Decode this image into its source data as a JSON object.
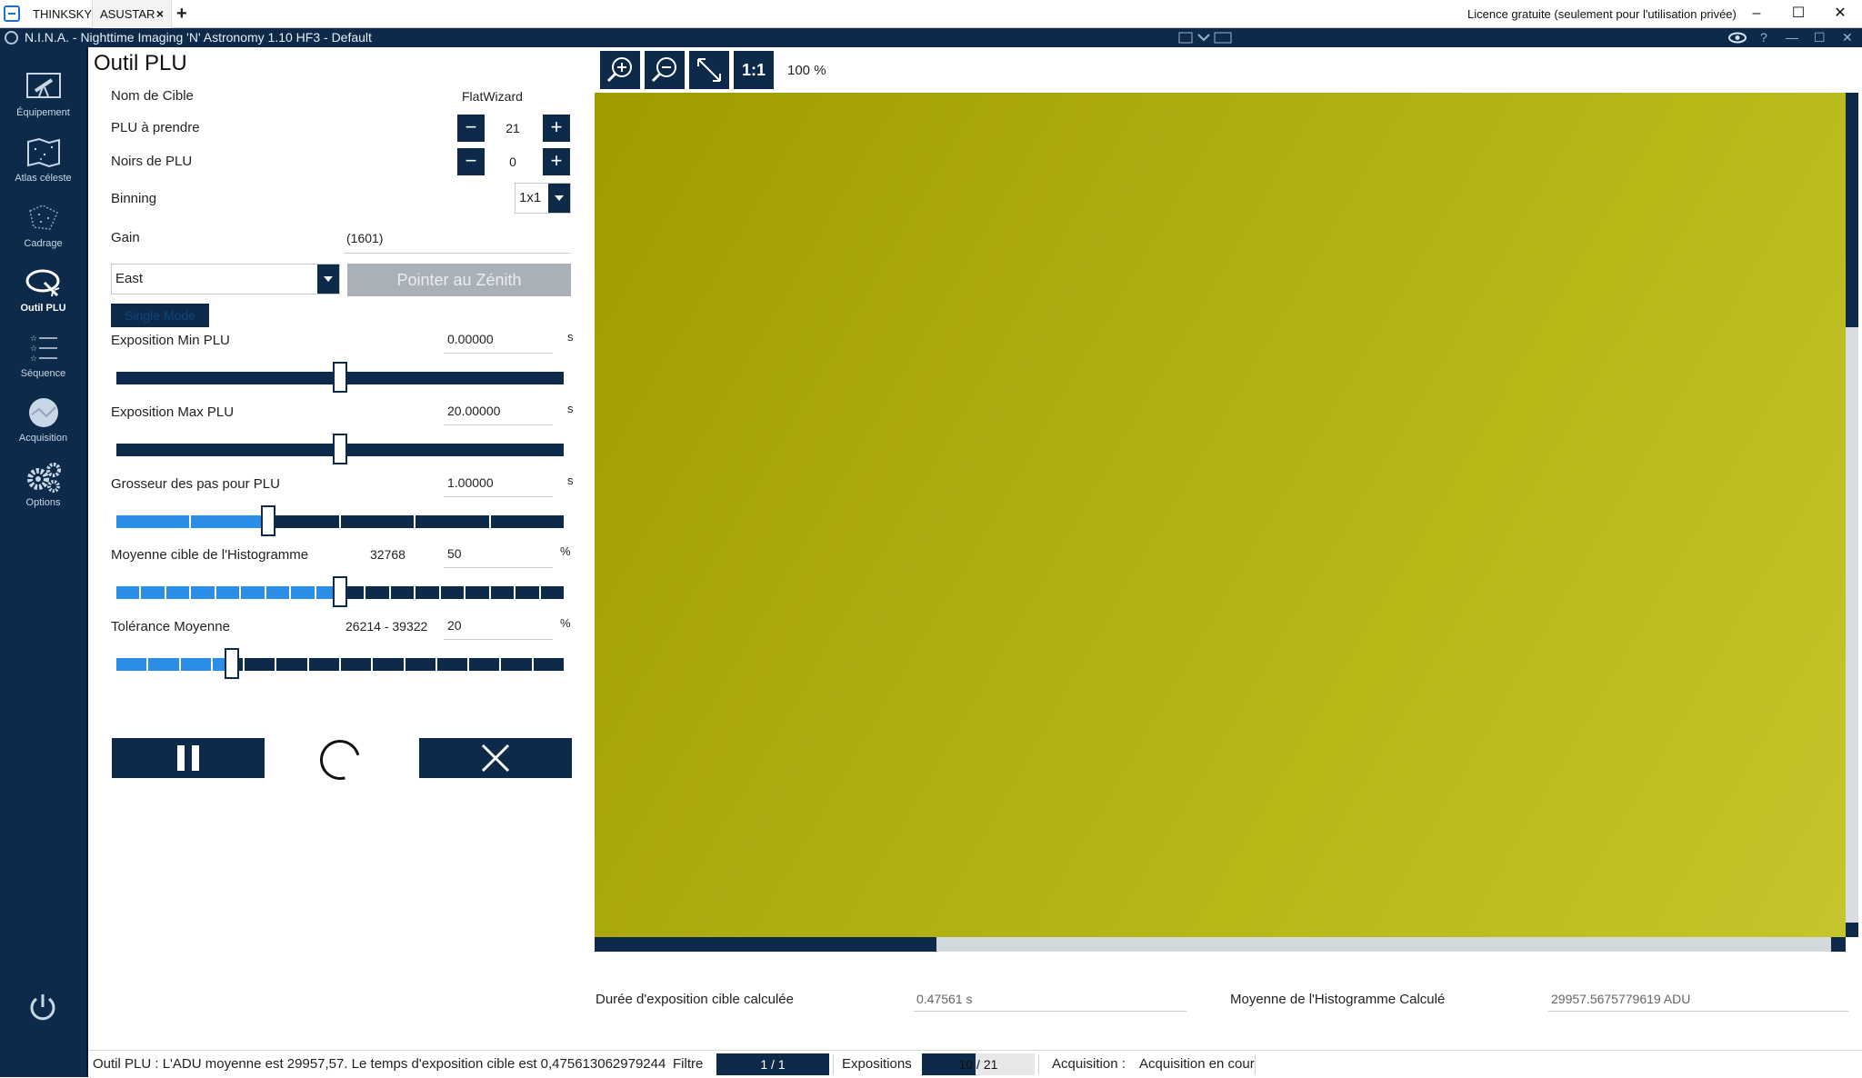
{
  "tabs": [
    {
      "label": "THINKSKY"
    },
    {
      "label": "ASUSTAR",
      "close": "×"
    }
  ],
  "new_tab": "+",
  "licence": "Licence gratuite (seulement pour l'utilisation privée)",
  "window_controls": {
    "minimize": "–",
    "maximize": "☐",
    "close": "✕"
  },
  "app": {
    "title": "N.I.N.A. - Nighttime Imaging 'N' Astronomy 1.10 HF3   -  Default"
  },
  "nav": [
    {
      "label": "Équipement",
      "icon": "telescope-icon"
    },
    {
      "label": "Atlas céleste",
      "icon": "sky-atlas-icon"
    },
    {
      "label": "Cadrage",
      "icon": "framing-icon"
    },
    {
      "label": "Outil PLU",
      "icon": "flat-wizard-icon",
      "active": true
    },
    {
      "label": "Séquence",
      "icon": "sequence-icon"
    },
    {
      "label": "Acquisition",
      "icon": "imaging-icon"
    },
    {
      "label": "Options",
      "icon": "gears-icon"
    }
  ],
  "panel": {
    "title": "Outil PLU",
    "target_name_label": "Nom de Cible",
    "target_name_value": "FlatWizard",
    "flats_label": "PLU à prendre",
    "flats_value": "21",
    "darks_label": "Noirs de PLU",
    "darks_value": "0",
    "binning_label": "Binning",
    "binning_value": "1x1",
    "gain_label": "Gain",
    "gain_value": "(1601)",
    "direction_value": "East",
    "zenith_button": "Pointer au Zénith",
    "single_mode": "Single Mode",
    "exp_min_label": "Exposition Min PLU",
    "exp_min_value": "0.00000",
    "exp_min_unit": "s",
    "exp_max_label": "Exposition Max PLU",
    "exp_max_value": "20.00000",
    "exp_max_unit": "s",
    "step_label": "Grosseur des pas pour PLU",
    "step_value": "1.00000",
    "step_unit": "s",
    "hist_label": "Moyenne cible de l'Histogramme",
    "hist_adu": "32768",
    "hist_value": "50",
    "hist_unit": "%",
    "tol_label": "Tolérance Moyenne",
    "tol_range": "26214 - 39322",
    "tol_value": "20",
    "tol_unit": "%",
    "sliders": {
      "exp_min": 0.5,
      "exp_max": 0.5,
      "step": 0.34,
      "hist": 0.5,
      "tol": 0.26
    },
    "pause_icon": "pause-icon",
    "cancel_icon": "close-icon"
  },
  "viewer": {
    "zoom_text": "100 %",
    "one_to_one": "1:1",
    "image_color": "#b2b112",
    "calc_exp_label": "Durée d'exposition cible calculée",
    "calc_exp_value": "0.47561 s",
    "calc_hist_label": "Moyenne de l'Histogramme Calculé",
    "calc_hist_value": "29957.5675779619 ADU"
  },
  "status": {
    "message": "Outil PLU :   L'ADU moyenne est 29957,57. Le temps d'exposition cible est 0,475613062979244",
    "filter_label": "Filtre",
    "filter_progress": "1 / 1",
    "filter_fraction": 1.0,
    "exposures_label": "Expositions",
    "exposures_progress": "10 / 21",
    "exposures_fraction": 0.476,
    "acq_label": "Acquisition :",
    "acq_value": "Acquisition en cour"
  },
  "colors": {
    "accent": "#0d2a4a",
    "slider_fill": "#2b8ee6"
  }
}
